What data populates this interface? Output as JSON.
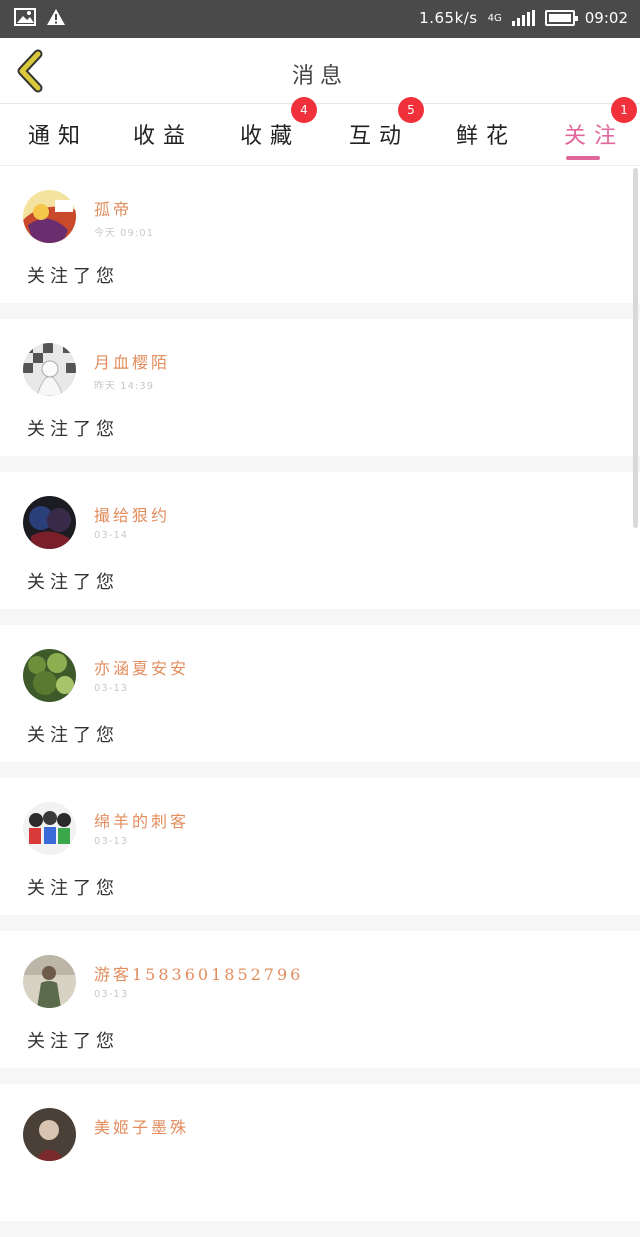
{
  "status_bar": {
    "net_speed": "1.65k/s",
    "net_type": "4G",
    "time": "09:02"
  },
  "header": {
    "title": "消息",
    "accent": "#d9c93a"
  },
  "tabs": [
    {
      "label": "通知",
      "badge": ""
    },
    {
      "label": "收益",
      "badge": ""
    },
    {
      "label": "收藏",
      "badge": "4"
    },
    {
      "label": "互动",
      "badge": "5"
    },
    {
      "label": "鲜花",
      "badge": ""
    },
    {
      "label": "关注",
      "badge": "1",
      "active": true
    }
  ],
  "messages": [
    {
      "name": "孤帝",
      "time": "今天 09:01",
      "text": "关注了您"
    },
    {
      "name": "月血樱陌",
      "time": "昨天 14:39",
      "text": "关注了您"
    },
    {
      "name": "撮给狠约",
      "time": "03-14",
      "text": "关注了您"
    },
    {
      "name": "亦涵夏安安",
      "time": "03-13",
      "text": "关注了您"
    },
    {
      "name": "绵羊的刺客",
      "time": "03-13",
      "text": "关注了您"
    },
    {
      "name": "游客1583601852796",
      "time": "03-13",
      "text": "关注了您"
    },
    {
      "name": "美姬子墨殊",
      "time": "",
      "text": ""
    }
  ],
  "colors": {
    "active_tab": "#e0679b",
    "username": "#e28d5e",
    "badge": "#f0303a"
  }
}
